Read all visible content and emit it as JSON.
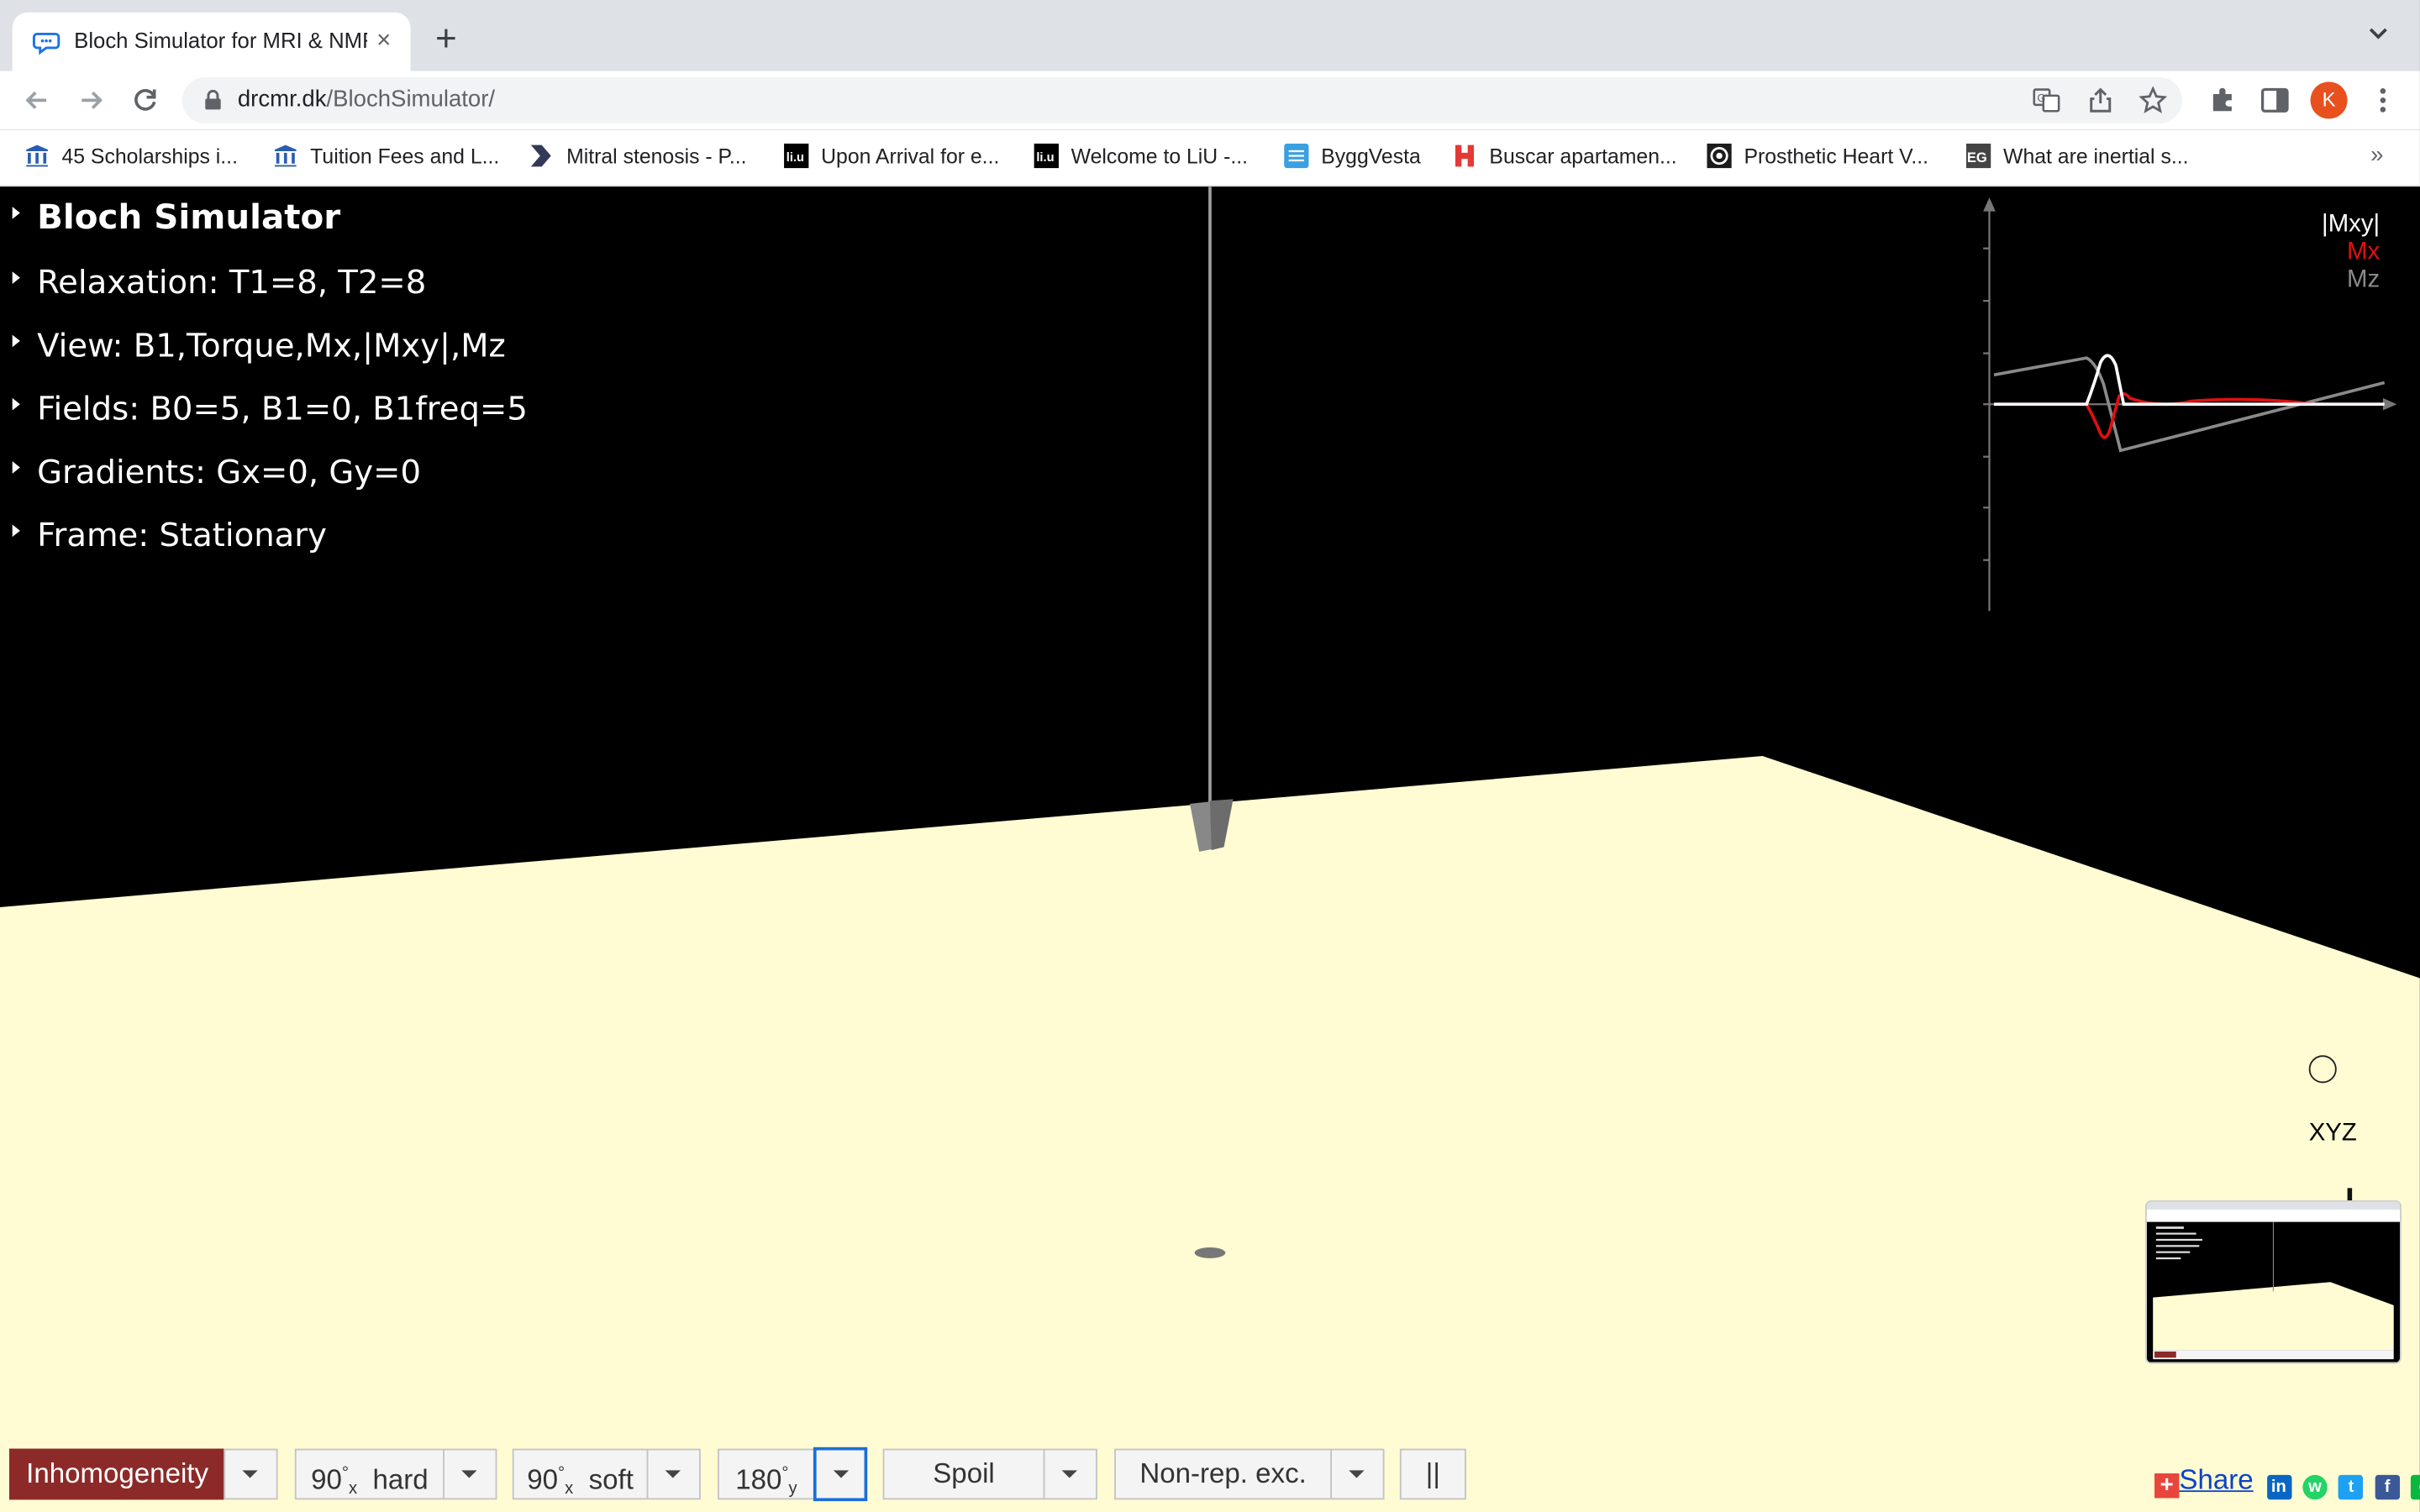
{
  "browser": {
    "tab_title": "Bloch Simulator for MRI & NMR",
    "new_tab_symbol": "+",
    "close_symbol": "×",
    "url_host": "drcmr.dk",
    "url_path": "/BlochSimulator/",
    "profile_initial": "K",
    "bookmarks": [
      {
        "label": "45 Scholarships i...",
        "icon": "building-icon",
        "color": "#2a5db0"
      },
      {
        "label": "Tuition Fees and L...",
        "icon": "building-icon",
        "color": "#2a5db0"
      },
      {
        "label": "Mitral stenosis - P...",
        "icon": "chevron-logo-icon",
        "color": "#333a57"
      },
      {
        "label": "Upon Arrival for e...",
        "icon": "liu-logo-icon",
        "color": "#000000"
      },
      {
        "label": "Welcome to LiU -...",
        "icon": "liu-logo-icon",
        "color": "#000000"
      },
      {
        "label": "ByggVesta",
        "icon": "globe-icon",
        "color": "#3ba0e0"
      },
      {
        "label": "Buscar apartamen...",
        "icon": "h-logo-icon",
        "color": "#e53935"
      },
      {
        "label": "Prosthetic Heart V...",
        "icon": "eye-logo-icon",
        "color": "#1c1c1c"
      },
      {
        "label": "What are inertial s...",
        "icon": "eg-logo-icon",
        "color": "#444444"
      }
    ],
    "more_bookmarks": "»"
  },
  "gui": {
    "title": "Bloch Simulator",
    "folders": [
      "Relaxation: T1=8, T2=8",
      "View: B1,Torque,Mx,|Mxy|,Mz",
      "Fields: B0=5, B1=0, B1freq=5",
      "Gradients: Gx=0, Gy=0",
      "Frame: Stationary"
    ]
  },
  "plot": {
    "legend": [
      {
        "label": "|Mxy|",
        "color": "#ffffff"
      },
      {
        "label": "Mx",
        "color": "#e01010"
      },
      {
        "label": "Mz",
        "color": "#8a8a8a"
      }
    ]
  },
  "gizmo": {
    "label": "XYZ"
  },
  "controls": {
    "inhomogeneity": "Inhomogeneity",
    "hard_angle": "90",
    "hard_axis": "x",
    "hard_label": "hard",
    "soft_angle": "90",
    "soft_axis": "x",
    "soft_label": "soft",
    "inv_angle": "180",
    "inv_axis": "y",
    "spoil": "Spoil",
    "nonrep": "Non-rep. exc.",
    "pause": "||",
    "degree": "°"
  },
  "share": {
    "label": "Share",
    "networks": [
      {
        "name": "linkedin-icon",
        "glyph": "in",
        "color": "#0a66c2"
      },
      {
        "name": "whatsapp-icon",
        "glyph": "w",
        "color": "#25d366"
      },
      {
        "name": "twitter-icon",
        "glyph": "t",
        "color": "#1da1f2"
      },
      {
        "name": "facebook-icon",
        "glyph": "f",
        "color": "#3b5998"
      },
      {
        "name": "wechat-icon",
        "glyph": "c",
        "color": "#09b83e"
      }
    ]
  },
  "colors": {
    "floor": "#fffbd2",
    "accent_red": "#8c2a2a"
  }
}
